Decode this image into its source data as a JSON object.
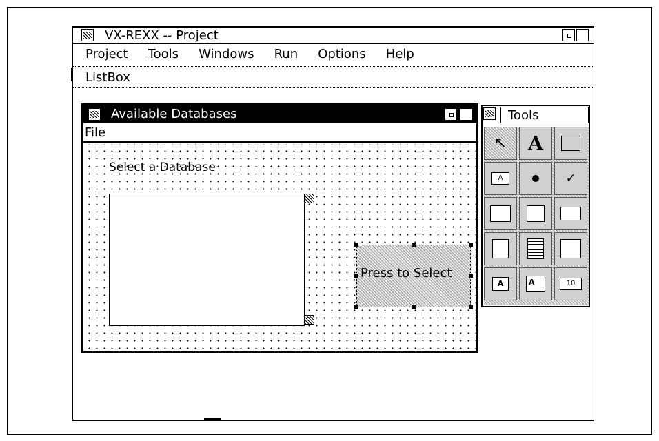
{
  "main_window": {
    "title": "VX-REXX -- Project",
    "menu": [
      {
        "label": "Project",
        "mnemonic": "P",
        "rest": "roject"
      },
      {
        "label": "Tools",
        "mnemonic": "T",
        "rest": "ools"
      },
      {
        "label": "Windows",
        "mnemonic": "W",
        "rest": "indows"
      },
      {
        "label": "Run",
        "mnemonic": "R",
        "rest": "un"
      },
      {
        "label": "Options",
        "mnemonic": "O",
        "rest": "ptions"
      },
      {
        "label": "Help",
        "mnemonic": "H",
        "rest": "elp"
      }
    ],
    "status": "ListBox"
  },
  "design_window": {
    "title": "Available Databases",
    "menu_file": "File",
    "prompt_text": "Select a Database",
    "button": {
      "label": "Press to Select",
      "mnemonic": "P",
      "rest": "ress to Select"
    }
  },
  "tools_palette": {
    "title": "Tools",
    "items": [
      "pointer-tool",
      "text-tool",
      "group-box-tool",
      "push-button-tool",
      "radio-button-tool",
      "check-box-tool",
      "picture-button-tool",
      "picture-radio-tool",
      "picture-box-tool",
      "slider-tool",
      "list-box-tool",
      "combo-box-tool",
      "entry-field-tool",
      "multiline-tool",
      "spin-button-tool"
    ],
    "spin_value": "10"
  },
  "colors": {
    "dither": "#000000",
    "button_fill": "#d8d8d8",
    "tool_bg": "#d0d0d0"
  }
}
